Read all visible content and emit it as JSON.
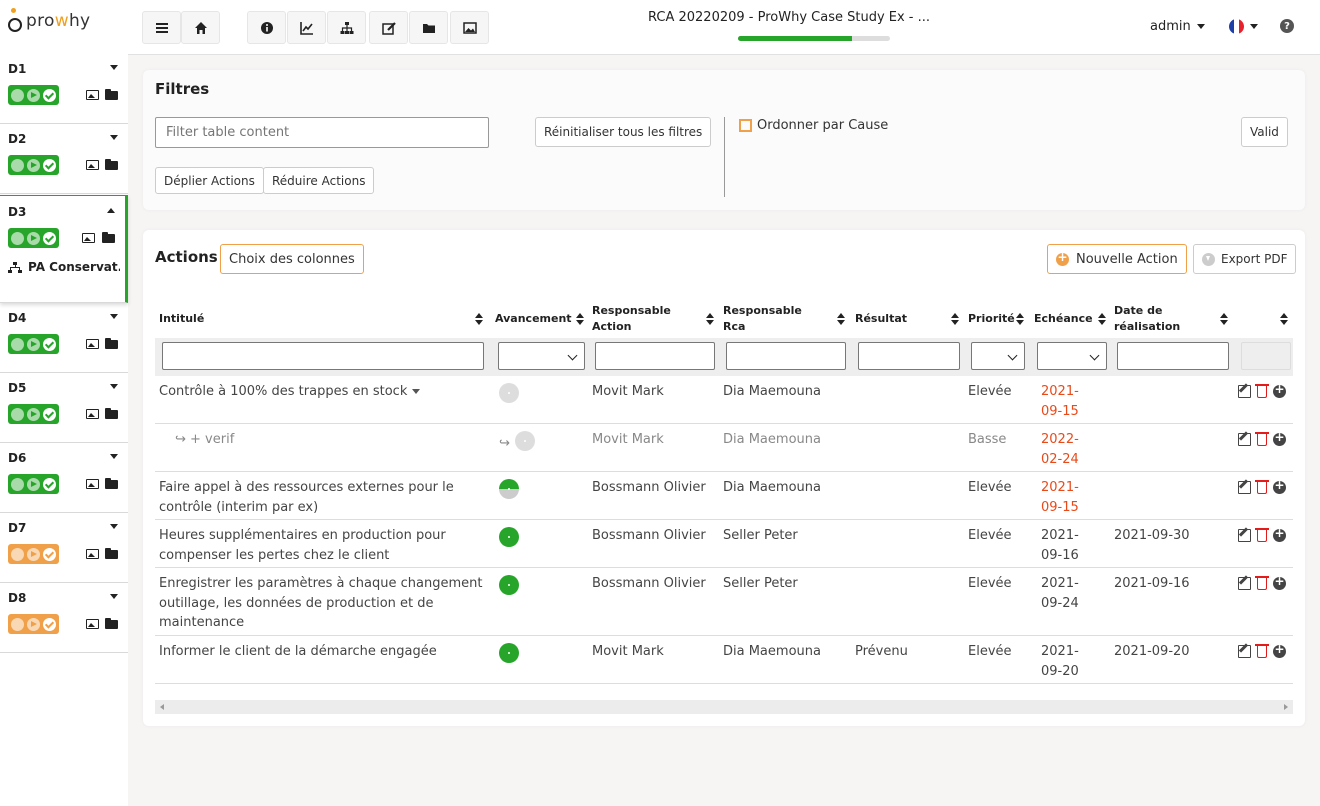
{
  "app": {
    "logo_prefix": "pro",
    "logo_accent": "w",
    "logo_suffix": "hy",
    "brand_color": "#f0a020"
  },
  "header": {
    "title": "RCA 20220209 - ProWhy Case Study Ex - ...",
    "progress_percent": 75,
    "user": "admin",
    "language_icon": "french-flag-icon",
    "toolbar_icons": [
      "menu-icon",
      "home-icon",
      "info-icon",
      "chart-icon",
      "sitemap-icon",
      "edit-icon",
      "folder-icon",
      "image-icon"
    ]
  },
  "sidebar": {
    "sections": [
      {
        "label": "D1",
        "status": "green"
      },
      {
        "label": "D2",
        "status": "green"
      },
      {
        "label": "D3",
        "status": "green",
        "expanded": true,
        "sub_item": "PA Conservat..."
      },
      {
        "label": "D4",
        "status": "green"
      },
      {
        "label": "D5",
        "status": "green"
      },
      {
        "label": "D6",
        "status": "green"
      },
      {
        "label": "D7",
        "status": "orange"
      },
      {
        "label": "D8",
        "status": "orange"
      }
    ]
  },
  "filters": {
    "title": "Filtres",
    "search_placeholder": "Filter table content",
    "reset_label": "Réinitialiser tous les filtres",
    "expand_label": "Déplier Actions",
    "collapse_label": "Réduire Actions",
    "order_by_cause_label": "Ordonner par Cause",
    "order_by_cause_checked": false,
    "valid_label": "Valid"
  },
  "actions": {
    "title": "Actions",
    "columns_label": "Choix des colonnes",
    "new_action_label": "Nouvelle Action",
    "export_label": "Export PDF",
    "columns": [
      "Intitulé",
      "Avancement",
      "Responsable Action",
      "Responsable Rca",
      "Résultat",
      "Priorité",
      "Echéance",
      "Date de réalisation",
      ""
    ],
    "rows": [
      {
        "intitule": "Contrôle à 100% des trappes en stock",
        "avancement": "grey",
        "resp_action": "Movit Mark",
        "resp_rca": "Dia Maemouna",
        "resultat": "",
        "priorite": "Elevée",
        "echeance": "2021-09-15",
        "echeance_overdue": true,
        "realisation": ""
      },
      {
        "intitule": "+ verif",
        "sub": true,
        "avancement": "grey",
        "resp_action": "Movit Mark",
        "resp_rca": "Dia Maemouna",
        "resultat": "",
        "priorite": "Basse",
        "echeance": "2022-02-24",
        "echeance_overdue": true,
        "realisation": ""
      },
      {
        "intitule": "Faire appel à des ressources externes pour le contrôle (interim par ex)",
        "avancement": "half",
        "resp_action": "Bossmann Olivier",
        "resp_rca": "Dia Maemouna",
        "resultat": "",
        "priorite": "Elevée",
        "echeance": "2021-09-15",
        "echeance_overdue": true,
        "realisation": ""
      },
      {
        "intitule": "Heures supplémentaires en production pour compenser les pertes chez le client",
        "avancement": "green",
        "resp_action": "Bossmann Olivier",
        "resp_rca": "Seller Peter",
        "resultat": "",
        "priorite": "Elevée",
        "echeance": "2021-09-16",
        "echeance_overdue": false,
        "realisation": "2021-09-30"
      },
      {
        "intitule": "Enregistrer les paramètres à chaque changement outillage, les données de production et de maintenance",
        "avancement": "green",
        "resp_action": "Bossmann Olivier",
        "resp_rca": "Seller Peter",
        "resultat": "",
        "priorite": "Elevée",
        "echeance": "2021-09-24",
        "echeance_overdue": false,
        "realisation": "2021-09-16"
      },
      {
        "intitule": "Informer le client de la démarche engagée",
        "avancement": "green",
        "resp_action": "Movit Mark",
        "resp_rca": "Dia Maemouna",
        "resultat": "Prévenu",
        "priorite": "Elevée",
        "echeance": "2021-09-20",
        "echeance_overdue": false,
        "realisation": "2021-09-20"
      }
    ]
  },
  "colors": {
    "green": "#27a52a",
    "orange": "#f0a048",
    "overdue": "#e84a1a"
  }
}
